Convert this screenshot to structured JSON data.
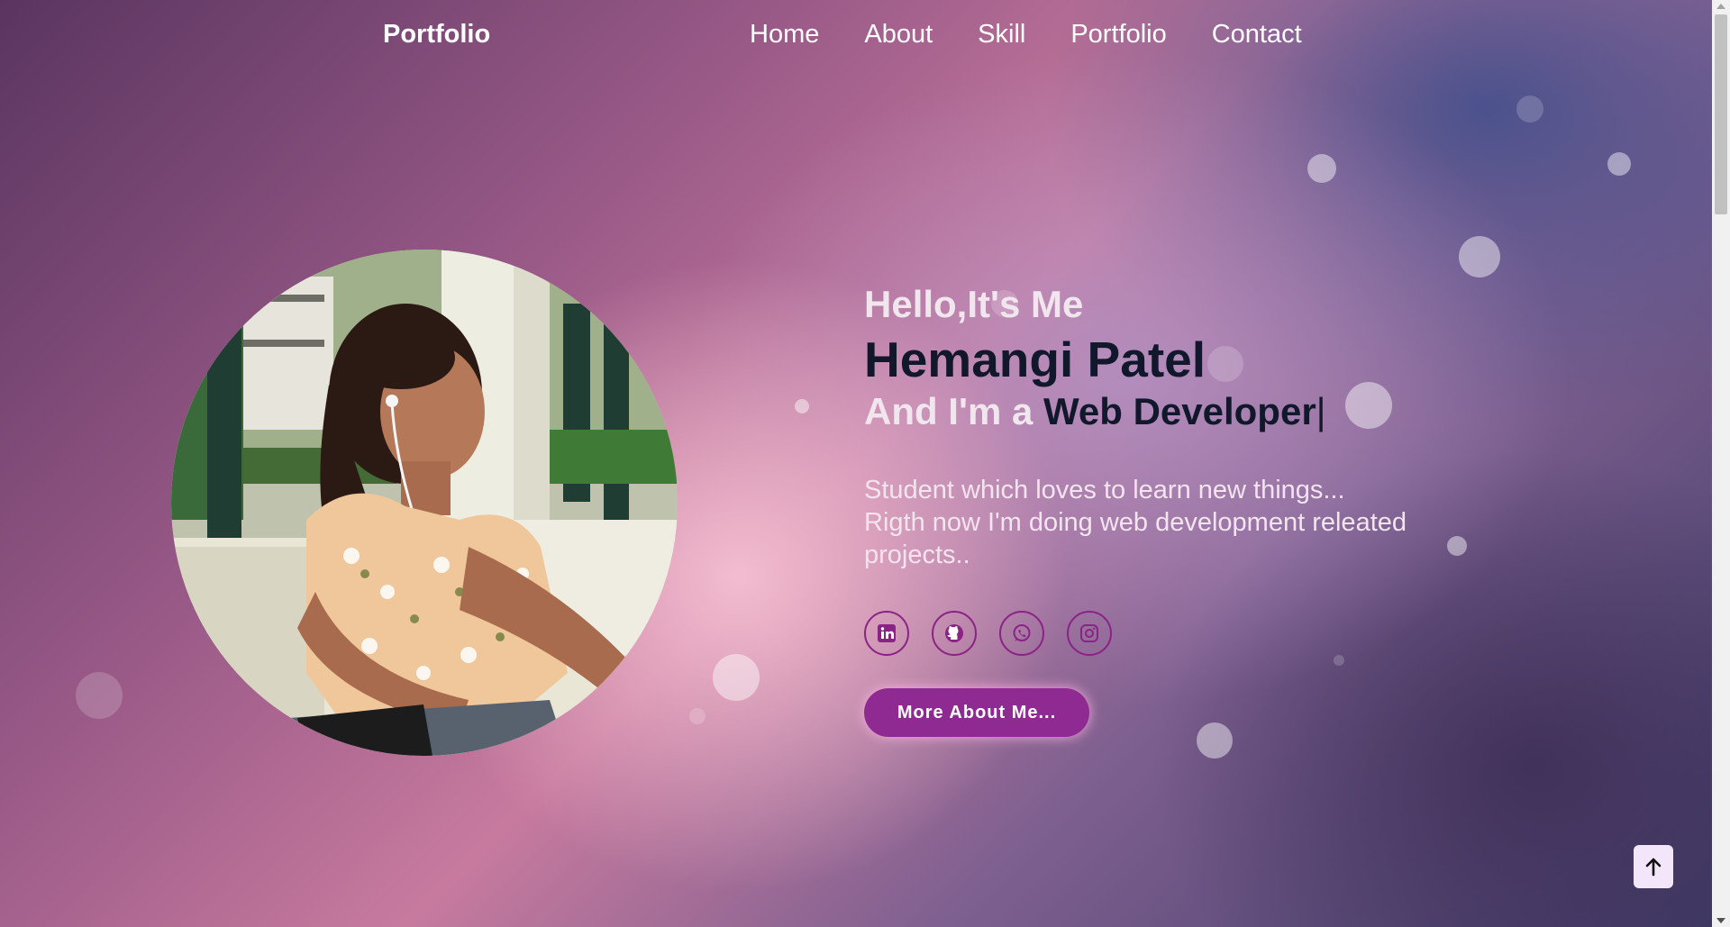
{
  "nav": {
    "logo": "Portfolio",
    "links": [
      "Home",
      "About",
      "Skill",
      "Portfolio",
      "Contact"
    ]
  },
  "hero": {
    "greeting": "Hello,It's Me",
    "name": "Hemangi Patel",
    "role_lead": "And I'm a ",
    "role_typed": "Web Developer",
    "cursor": "|",
    "desc_line1": "Student which loves to learn new things...",
    "desc_line2": "Rigth now I'm doing web development releated projects..",
    "cta_label": "More About Me...",
    "photo_alt": "Hemangi Patel"
  },
  "socials": [
    "linkedin-icon",
    "github-icon",
    "whatsapp-icon",
    "instagram-icon"
  ],
  "colors": {
    "accent": "#8f2a92",
    "name_text": "#11182b",
    "light_text": "#f1e6ee"
  }
}
